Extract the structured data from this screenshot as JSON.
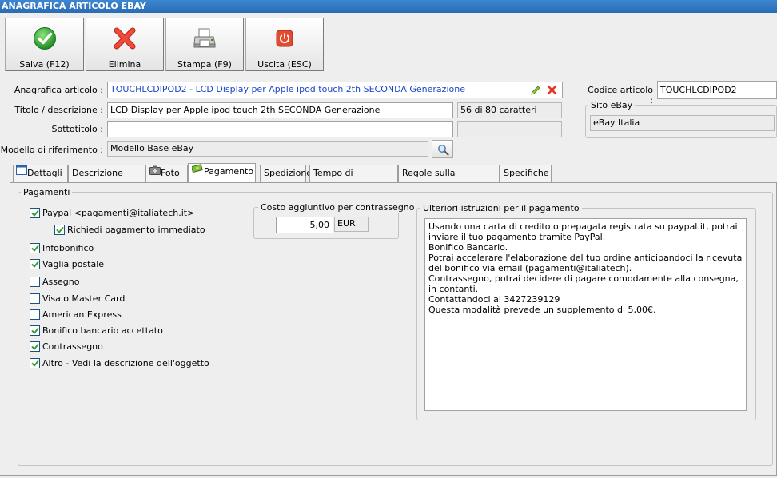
{
  "window": {
    "title": "ANAGRAFICA ARTICOLO EBAY"
  },
  "toolbar": {
    "save_label": "Salva (F12)",
    "delete_label": "Elimina",
    "print_label": "Stampa (F9)",
    "exit_label": "Uscita (ESC)"
  },
  "form": {
    "anagrafica_label": "Anagrafica articolo :",
    "anagrafica_value": "TOUCHLCDIPOD2 - LCD Display per Apple ipod touch 2th SECONDA Generazione",
    "titolo_label": "Titolo / descrizione :",
    "titolo_value": "LCD Display per Apple ipod touch 2th SECONDA Generazione",
    "char_count": "56 di 80 caratteri",
    "sottotitolo_label": "Sottotitolo :",
    "sottotitolo_value": "",
    "modello_label": "Modello di riferimento :",
    "modello_value": "Modello Base eBay",
    "codice_label": "Codice articolo :",
    "codice_value": "TOUCHLCDIPOD2",
    "sito_legend": "Sito eBay",
    "sito_value": "eBay Italia"
  },
  "tabs": [
    {
      "label": "Dettagli"
    },
    {
      "label": "Descrizione estesa"
    },
    {
      "label": "Foto"
    },
    {
      "label": "Pagamento"
    },
    {
      "label": "Spedizione"
    },
    {
      "label": "Tempo di imballaggio"
    },
    {
      "label": "Regole sulla restituzione"
    },
    {
      "label": "Specifiche"
    }
  ],
  "active_tab": "Pagamento",
  "payments": {
    "legend": "Pagamenti",
    "items": [
      {
        "label": "Paypal <pagamenti@italiatech.it>",
        "checked": true
      },
      {
        "label": "Richiedi pagamento immediato",
        "checked": true
      },
      {
        "label": "Infobonifico",
        "checked": true
      },
      {
        "label": "Vaglia postale",
        "checked": true
      },
      {
        "label": "Assegno",
        "checked": false
      },
      {
        "label": "Visa o Master Card",
        "checked": false
      },
      {
        "label": "American Express",
        "checked": false
      },
      {
        "label": "Bonifico bancario accettato",
        "checked": true
      },
      {
        "label": "Contrassegno",
        "checked": true
      },
      {
        "label": "Altro - Vedi la descrizione dell'oggetto",
        "checked": true
      }
    ]
  },
  "contrassegno": {
    "legend": "Costo aggiuntivo per contrassegno",
    "amount": "5,00",
    "currency": "EUR"
  },
  "istruzioni": {
    "legend": "Ulteriori istruzioni per il pagamento",
    "text": "Usando una carta di credito o prepagata registrata su paypal.it, potrai inviare il tuo pagamento tramite PayPal.\nBonifico Bancario.\nPotrai accelerare l'elaborazione del tuo ordine anticipandoci la ricevuta del bonifico via email (pagamenti@italiatech).\nContrassegno, potrai decidere di pagare comodamente alla consegna, in contanti.\nContattandoci al 3427239129\nQuesta modalità prevede un supplemento di 5,00€."
  },
  "icons": {
    "save": "check-circle-icon",
    "delete": "x-icon",
    "print": "printer-icon",
    "exit": "power-icon",
    "edit": "pencil-icon",
    "clear": "x-small-icon",
    "search": "magnifier-icon"
  },
  "colors": {
    "titlebar": "#2f74c0",
    "link_text": "#1c46c9",
    "check_green": "#2a9d2a",
    "delete_red": "#e0392b",
    "exit_red": "#e34a2f"
  }
}
